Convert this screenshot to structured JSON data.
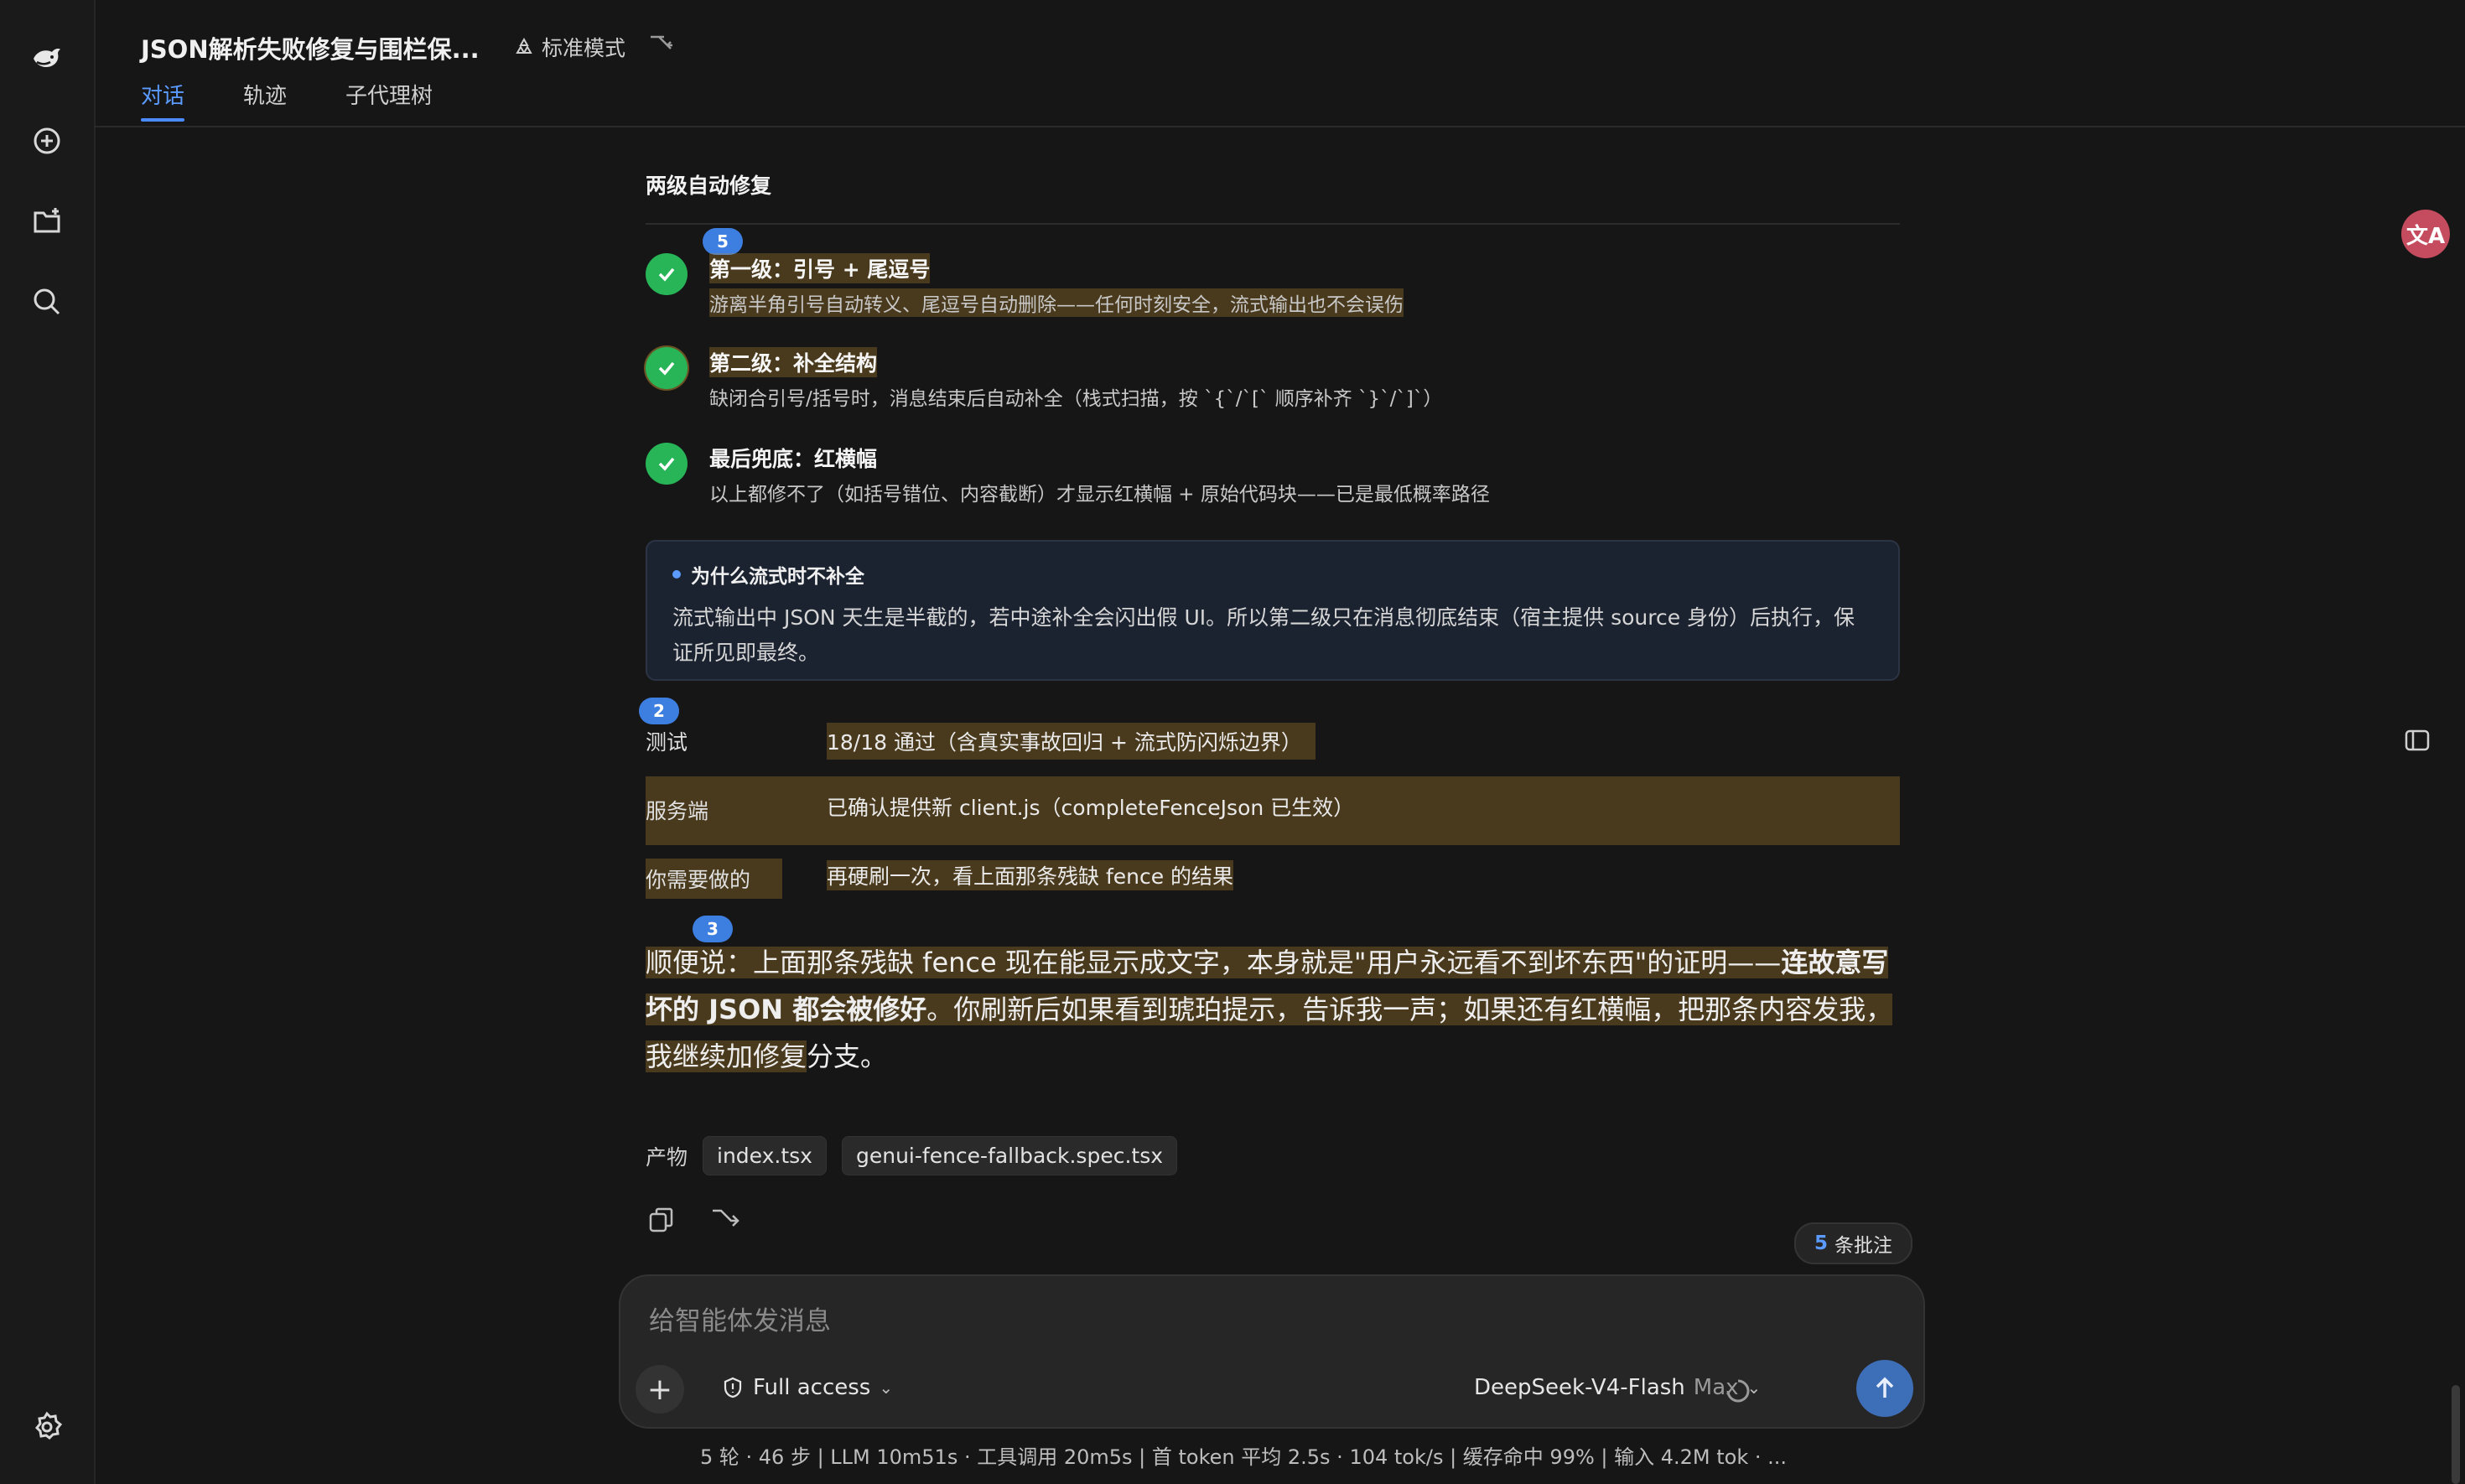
{
  "header": {
    "title": "JSON解析失败修复与围栏保...",
    "mode_label": "标准模式",
    "tabs": [
      {
        "label": "对话",
        "active": true
      },
      {
        "label": "轨迹",
        "active": false
      },
      {
        "label": "子代理树",
        "active": false
      }
    ]
  },
  "sidebar": {
    "icons": [
      "whale-logo-icon",
      "new-chat-icon",
      "new-folder-icon",
      "search-icon",
      "settings-icon"
    ]
  },
  "section": {
    "heading": "两级自动修复",
    "steps": [
      {
        "badge": "5",
        "title": "第一级：引号 + 尾逗号",
        "desc": "游离半角引号自动转义、尾逗号自动删除——任何时刻安全，流式输出也不会误伤"
      },
      {
        "title": "第二级：补全结构",
        "desc": "缺闭合引号/括号时，消息结束后自动补全（栈式扫描，按 `{`/`[` 顺序补齐 `}`/`]`）"
      },
      {
        "title": "最后兜底：红横幅",
        "desc": "以上都修不了（如括号错位、内容截断）才显示红横幅 + 原始代码块——已是最低概率路径"
      }
    ],
    "note": {
      "title": "为什么流式时不补全",
      "body": "流式输出中 JSON 天生是半截的，若中途补全会闪出假 UI。所以第二级只在消息彻底结束（宿主提供 source 身份）后执行，保证所见即最终。"
    }
  },
  "kv": {
    "badge": "2",
    "rows": [
      {
        "key": "测试",
        "value": "18/18 通过（含真实事故回归 + 流式防闪烁边界）"
      },
      {
        "key": "服务端",
        "value": "已确认提供新 client.js（completeFenceJson 已生效）"
      },
      {
        "key": "你需要做的",
        "value": "再硬刷一次，看上面那条残缺 fence 的结果"
      }
    ]
  },
  "paragraph": {
    "badge": "3",
    "part1": "顺便说：上面那条残缺 fence 现在能显示成文字，本身就是\"用户永远看不到坏东西\"的证明——",
    "bold": "连故意写坏的 JSON 都会被修好",
    "part2": "。你刷新后如果看到琥珀提示，告诉我一声；如果还有红横幅，把那条内容发我，我继续加修复",
    "part3": "分支。"
  },
  "artifacts": {
    "label": "产物",
    "files": [
      "index.tsx",
      "genui-fence-fallback.spec.tsx"
    ]
  },
  "annotations": {
    "count": "5",
    "label": "条批注"
  },
  "composer": {
    "placeholder": "给智能体发消息",
    "access": "Full access",
    "model": "DeepSeek-V4-Flash",
    "tier": "Max"
  },
  "status": "5 轮 · 46 步 | LLM 10m51s · 工具调用 20m5s | 首 token 平均 2.5s · 104 tok/s | 缓存命中 99% | 输入 4.2M tok · ...",
  "translate_glyph": "文A",
  "colors": {
    "accent": "#4a8cff",
    "success": "#27b558",
    "highlight": "#c48e30",
    "background": "#161616"
  }
}
